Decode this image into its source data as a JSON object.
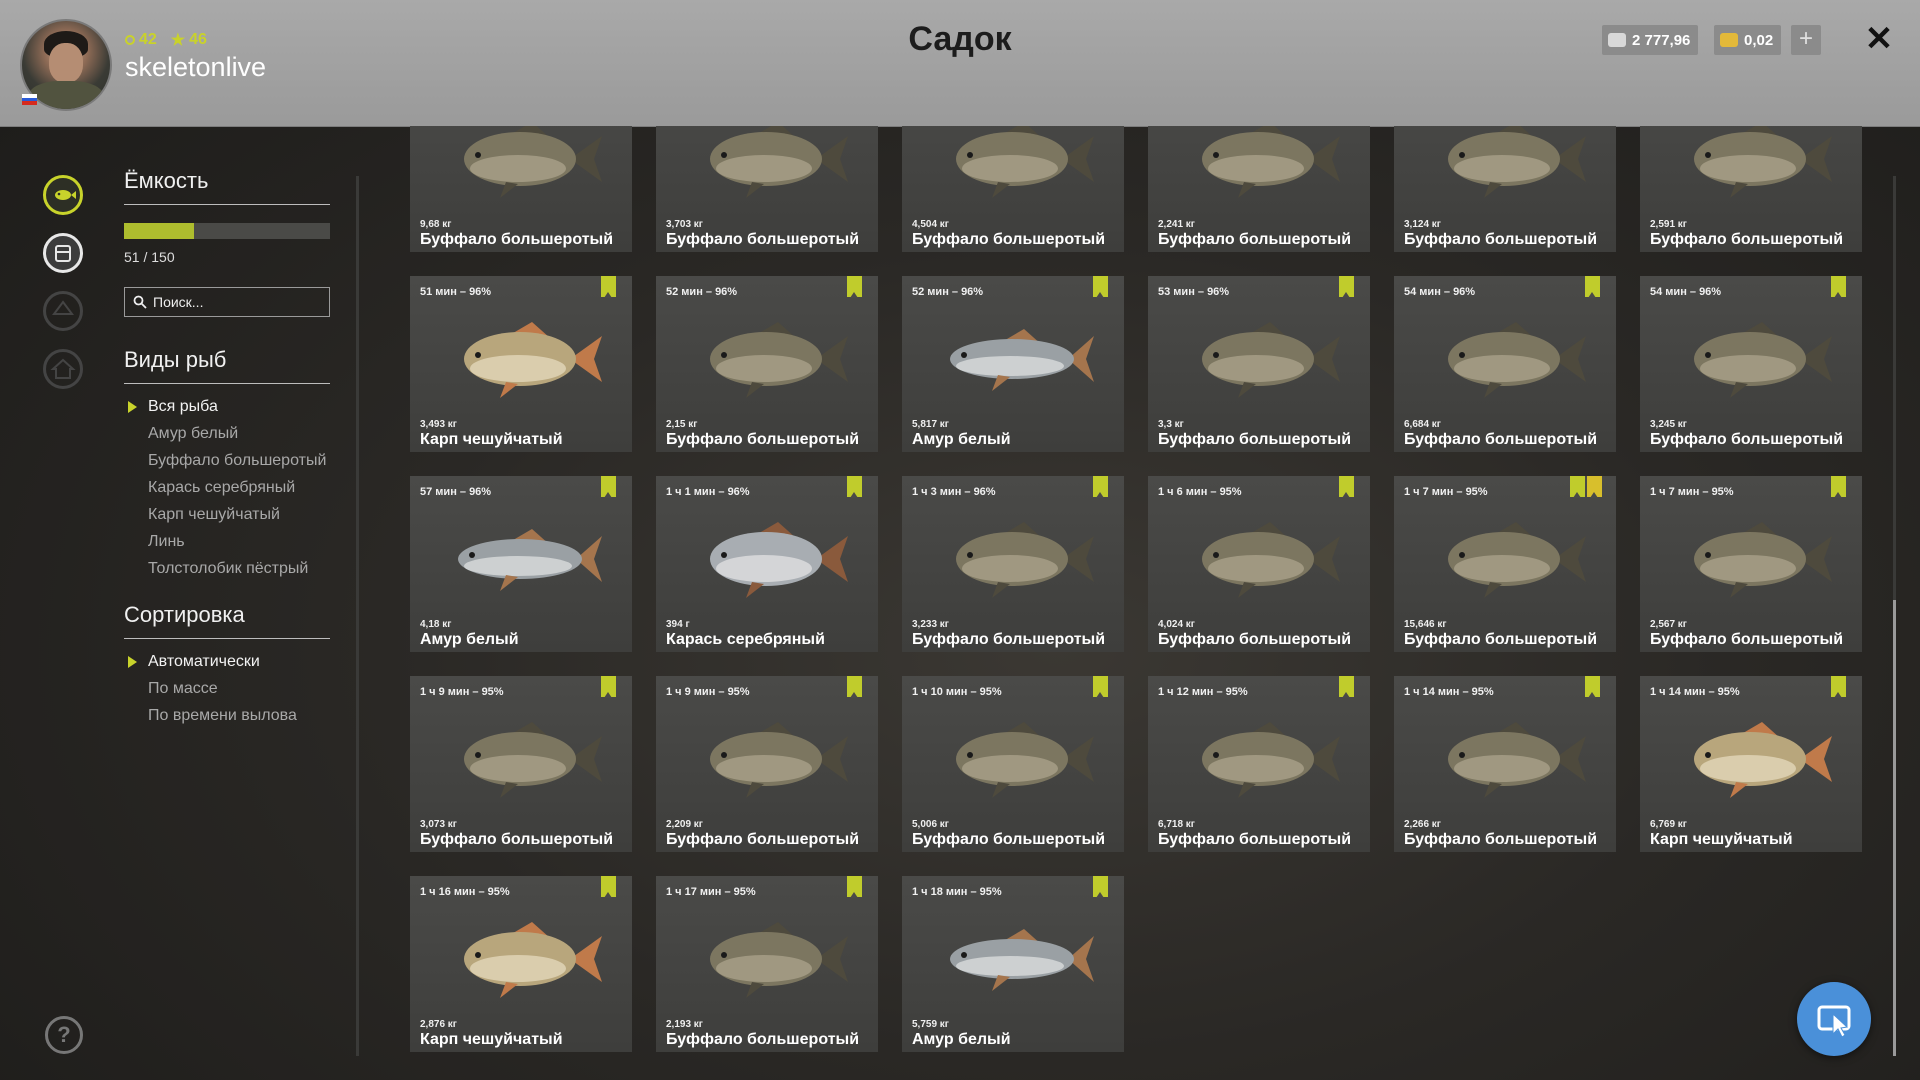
{
  "header": {
    "title": "Садок",
    "username": "skeletonlive",
    "level": "42",
    "rank": "46",
    "silver": "2 777,96",
    "gold": "0,02",
    "plus_label": "+",
    "close_label": "✕"
  },
  "panel": {
    "capacity_title": "Ёмкость",
    "capacity_text": "51 / 150",
    "capacity_fraction": 0.34,
    "search_placeholder": "Поиск...",
    "species_title": "Виды рыб",
    "species": [
      "Вся рыба",
      "Амур белый",
      "Буффало большеротый",
      "Карась серебряный",
      "Карп чешуйчатый",
      "Линь",
      "Толстолобик пёстрый"
    ],
    "sort_title": "Сортировка",
    "sort": [
      "Автоматически",
      "По массе",
      "По времени вылова"
    ]
  },
  "colors": {
    "accent": "#c8d32b",
    "fab": "#4a90d9"
  },
  "fish": [
    {
      "time": "",
      "weight": "9,68 кг",
      "name": "Буффало большеротый",
      "type": "buffalo",
      "bookmark": false
    },
    {
      "time": "",
      "weight": "3,703 кг",
      "name": "Буффало большеротый",
      "type": "buffalo",
      "bookmark": false
    },
    {
      "time": "",
      "weight": "4,504 кг",
      "name": "Буффало большеротый",
      "type": "buffalo",
      "bookmark": false
    },
    {
      "time": "",
      "weight": "2,241 кг",
      "name": "Буффало большеротый",
      "type": "buffalo",
      "bookmark": false
    },
    {
      "time": "",
      "weight": "3,124 кг",
      "name": "Буффало большеротый",
      "type": "buffalo",
      "bookmark": false
    },
    {
      "time": "",
      "weight": "2,591 кг",
      "name": "Буффало большеротый",
      "type": "buffalo",
      "bookmark": false
    },
    {
      "time": "51 мин – 96%",
      "weight": "3,493 кг",
      "name": "Карп чешуйчатый",
      "type": "carp",
      "bookmark": true
    },
    {
      "time": "52 мин – 96%",
      "weight": "2,15 кг",
      "name": "Буффало большеротый",
      "type": "buffalo",
      "bookmark": true
    },
    {
      "time": "52 мин – 96%",
      "weight": "5,817 кг",
      "name": "Амур белый",
      "type": "amur",
      "bookmark": true
    },
    {
      "time": "53 мин – 96%",
      "weight": "3,3 кг",
      "name": "Буффало большеротый",
      "type": "buffalo",
      "bookmark": true
    },
    {
      "time": "54 мин – 96%",
      "weight": "6,684 кг",
      "name": "Буффало большеротый",
      "type": "buffalo",
      "bookmark": true
    },
    {
      "time": "54 мин – 96%",
      "weight": "3,245 кг",
      "name": "Буффало большеротый",
      "type": "buffalo",
      "bookmark": true
    },
    {
      "time": "57 мин – 96%",
      "weight": "4,18 кг",
      "name": "Амур белый",
      "type": "amur",
      "bookmark": true
    },
    {
      "time": "1 ч 1 мин – 96%",
      "weight": "394 г",
      "name": "Карась серебряный",
      "type": "crucian",
      "bookmark": true
    },
    {
      "time": "1 ч 3 мин – 96%",
      "weight": "3,233 кг",
      "name": "Буффало большеротый",
      "type": "buffalo",
      "bookmark": true
    },
    {
      "time": "1 ч 6 мин – 95%",
      "weight": "4,024 кг",
      "name": "Буффало большеротый",
      "type": "buffalo",
      "bookmark": true
    },
    {
      "time": "1 ч 7 мин – 95%",
      "weight": "15,646 кг",
      "name": "Буффало большеротый",
      "type": "buffalo",
      "bookmark": true,
      "star": true
    },
    {
      "time": "1 ч 7 мин – 95%",
      "weight": "2,567 кг",
      "name": "Буффало большеротый",
      "type": "buffalo",
      "bookmark": true
    },
    {
      "time": "1 ч 9 мин – 95%",
      "weight": "3,073 кг",
      "name": "Буффало большеротый",
      "type": "buffalo",
      "bookmark": true
    },
    {
      "time": "1 ч 9 мин – 95%",
      "weight": "2,209 кг",
      "name": "Буффало большеротый",
      "type": "buffalo",
      "bookmark": true
    },
    {
      "time": "1 ч 10 мин – 95%",
      "weight": "5,006 кг",
      "name": "Буффало большеротый",
      "type": "buffalo",
      "bookmark": true
    },
    {
      "time": "1 ч 12 мин – 95%",
      "weight": "6,718 кг",
      "name": "Буффало большеротый",
      "type": "buffalo",
      "bookmark": true
    },
    {
      "time": "1 ч 14 мин – 95%",
      "weight": "2,266 кг",
      "name": "Буффало большеротый",
      "type": "buffalo",
      "bookmark": true
    },
    {
      "time": "1 ч 14 мин – 95%",
      "weight": "6,769 кг",
      "name": "Карп чешуйчатый",
      "type": "carp",
      "bookmark": true
    },
    {
      "time": "1 ч 16 мин – 95%",
      "weight": "2,876 кг",
      "name": "Карп чешуйчатый",
      "type": "carp",
      "bookmark": true
    },
    {
      "time": "1 ч 17 мин – 95%",
      "weight": "2,193 кг",
      "name": "Буффало большеротый",
      "type": "buffalo",
      "bookmark": true
    },
    {
      "time": "1 ч 18 мин – 95%",
      "weight": "5,759 кг",
      "name": "Амур белый",
      "type": "amur",
      "bookmark": true
    }
  ]
}
